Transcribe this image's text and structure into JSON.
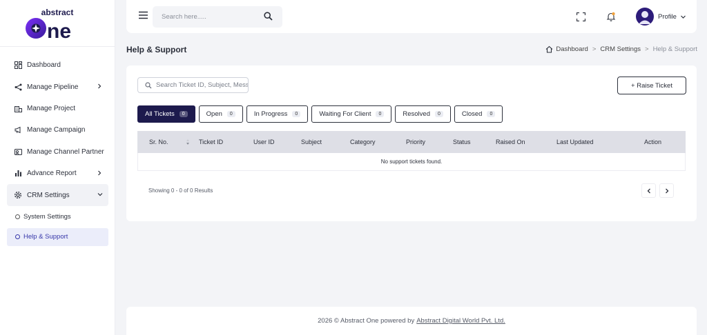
{
  "brand": {
    "name_top": "abstract",
    "name_main": "one",
    "primary_color": "#1d1a4d",
    "accent_color": "#7b2ff7"
  },
  "sidebar": {
    "items": [
      {
        "label": "Dashboard",
        "icon": "grid-icon",
        "has_chevron": false
      },
      {
        "label": "Manage Pipeline",
        "icon": "pipeline-icon",
        "has_chevron": true
      },
      {
        "label": "Manage Project",
        "icon": "building-icon",
        "has_chevron": false
      },
      {
        "label": "Manage Campaign",
        "icon": "megaphone-icon",
        "has_chevron": false
      },
      {
        "label": "Manage Channel Partner",
        "icon": "partner-icon",
        "has_chevron": false
      },
      {
        "label": "Advance Report",
        "icon": "bar-chart-icon",
        "has_chevron": true
      },
      {
        "label": "CRM Settings",
        "icon": "gear-icon",
        "has_chevron": true,
        "expanded": true
      }
    ],
    "sub_items": [
      {
        "label": "System Settings",
        "active": false
      },
      {
        "label": "Help & Support",
        "active": true
      }
    ]
  },
  "topbar": {
    "search_placeholder": "Search here.....",
    "profile_label": "Profile"
  },
  "page": {
    "title": "Help & Support",
    "breadcrumb": [
      "Dashboard",
      "CRM Settings",
      "Help & Support"
    ]
  },
  "tickets": {
    "search_placeholder": "Search Ticket ID, Subject, Message...",
    "raise_button": "+ Raise Ticket",
    "tabs": [
      {
        "label": "All Tickets",
        "count": "0",
        "active": true
      },
      {
        "label": "Open",
        "count": "0",
        "active": false
      },
      {
        "label": "In Progress",
        "count": "0",
        "active": false
      },
      {
        "label": "Waiting For Client",
        "count": "0",
        "active": false
      },
      {
        "label": "Resolved",
        "count": "0",
        "active": false
      },
      {
        "label": "Closed",
        "count": "0",
        "active": false
      }
    ],
    "columns": [
      "Sr. No.",
      "Ticket ID",
      "User ID",
      "Subject",
      "Category",
      "Priority",
      "Status",
      "Raised On",
      "Last Updated",
      "Action"
    ],
    "empty_message": "No support tickets found.",
    "showing_text": "Showing 0 - 0 of 0 Results"
  },
  "footer": {
    "text": "2026 © Abstract One powered by",
    "link": "Abstract Digital World Pvt. Ltd."
  }
}
